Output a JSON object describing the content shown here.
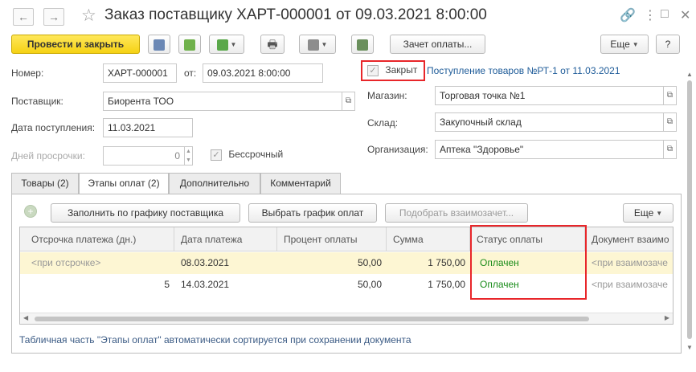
{
  "window": {
    "title": "Заказ поставщику ХАРТ-000001 от 09.03.2021 8:00:00",
    "back_icon": "arrow-left-icon",
    "forward_icon": "arrow-right-icon",
    "favorite_icon": "star-icon",
    "link_icon": "link-icon",
    "more_icon": "kebab-menu-icon",
    "restore_icon": "restore-window-icon",
    "close_icon": "close-icon"
  },
  "toolbar": {
    "post_close_label": "Провести и закрыть",
    "pay_offset_label": "Зачет оплаты...",
    "more_label": "Еще",
    "help_label": "?"
  },
  "form": {
    "number_label": "Номер:",
    "number_value": "ХАРТ-000001",
    "from_label": "от:",
    "date_value": "09.03.2021  8:00:00",
    "supplier_label": "Поставщик:",
    "supplier_value": "Биорента ТОО",
    "receipt_date_label": "Дата поступления:",
    "receipt_date_value": "11.03.2021",
    "overdue_label": "Дней просрочки:",
    "overdue_value": "0",
    "indefinite_label": "Бессрочный",
    "closed_label": "Закрыт",
    "receipt_link": "Поступление товаров №РТ-1 от 11.03.2021",
    "store_label": "Магазин:",
    "store_value": "Торговая точка №1",
    "warehouse_label": "Склад:",
    "warehouse_value": "Закупочный склад",
    "org_label": "Организация:",
    "org_value": "Аптека \"Здоровье\""
  },
  "tabs": [
    {
      "label": "Товары (2)"
    },
    {
      "label": "Этапы оплат (2)"
    },
    {
      "label": "Дополнительно"
    },
    {
      "label": "Комментарий"
    }
  ],
  "stages": {
    "fill_label": "Заполнить по графику поставщика",
    "choose_label": "Выбрать график оплат",
    "match_label": "Подобрать взаимозачет...",
    "more_label": "Еще",
    "columns": [
      "Отсрочка платежа (дн.)",
      "Дата платежа",
      "Процент оплаты",
      "Сумма",
      "Статус оплаты",
      "Документ взаимо"
    ],
    "rows": [
      {
        "delay": "<при отсрочке>",
        "date": "08.03.2021",
        "percent": "50,00",
        "sum": "1 750,00",
        "status": "Оплачен",
        "doc": "<при взаимозаче"
      },
      {
        "delay": "5",
        "date": "14.03.2021",
        "percent": "50,00",
        "sum": "1 750,00",
        "status": "Оплачен",
        "doc": "<при взаимозаче"
      }
    ],
    "footnote": "Табличная часть \"Этапы оплат\" автоматически сортируется при сохранении документа"
  },
  "colors": {
    "primary_button": "#f5d214",
    "selected_row": "#fdf6d3",
    "highlight": "#e8262a",
    "status_paid": "#1a8c1a",
    "link": "#1f5c99"
  }
}
